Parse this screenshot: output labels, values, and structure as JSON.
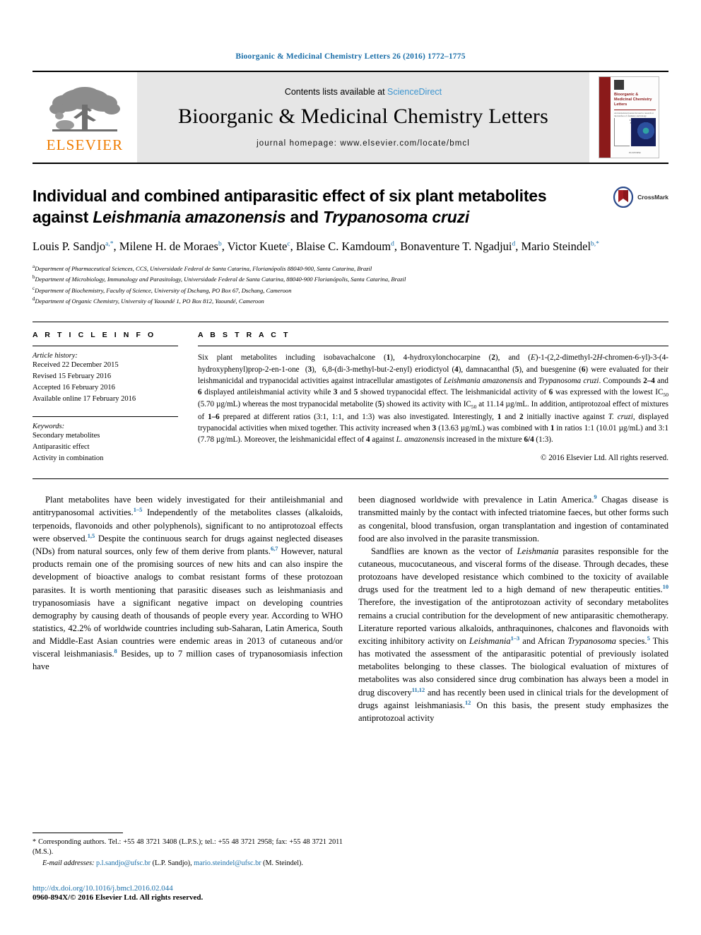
{
  "running_head": "Bioorganic & Medicinal Chemistry Letters 26 (2016) 1772–1775",
  "masthead": {
    "publisher_name": "ELSEVIER",
    "contents_prefix": "Contents lists available at ",
    "contents_link": "ScienceDirect",
    "journal_title": "Bioorganic & Medicinal Chemistry Letters",
    "homepage": "journal homepage: www.elsevier.com/locate/bmcl",
    "cover": {
      "title": "Bioorganic & Medicinal Chemistry Letters",
      "subtitle": "An international journal devoted to research at the interface of chemistry and biology",
      "volume_line": "Volume 26    Issue 7    1 April 2016",
      "editors": "Editors-in-Chief: B. E. Maryanoff, J. D. Elliott",
      "footer": "ELSEVIER",
      "figure_caption": "Available online at www.sciencedirect.com"
    }
  },
  "article": {
    "title_line1": "Individual and combined antiparasitic effect of six plant metabolites",
    "title_line2_pre": "against ",
    "title_line2_italic1": "Leishmania amazonensis",
    "title_line2_mid": " and ",
    "title_line2_italic2": "Trypanosoma cruzi",
    "crossmark_label": "CrossMark",
    "authors": [
      {
        "name": "Louis P. Sandjo",
        "marks": "a,*"
      },
      {
        "name": "Milene H. de Moraes",
        "marks": "b"
      },
      {
        "name": "Victor Kuete",
        "marks": "c"
      },
      {
        "name": "Blaise C. Kamdoum",
        "marks": "d"
      },
      {
        "name": "Bonaventure T. Ngadjui",
        "marks": "d"
      },
      {
        "name": "Mario Steindel",
        "marks": "b,*"
      }
    ],
    "affiliations": [
      {
        "mark": "a",
        "text": "Department of Pharmaceutical Sciences, CCS, Universidade Federal de Santa Catarina, Florianópolis 88040-900, Santa Catarina, Brazil"
      },
      {
        "mark": "b",
        "text": "Department of Microbiology, Immunology and Parasitology, Universidade Federal de Santa Catarina, 88040-900 Florianópolis, Santa Catarina, Brazil"
      },
      {
        "mark": "c",
        "text": "Department of Biochemistry, Faculty of Science, University of Dschang, PO Box 67, Dschang, Cameroon"
      },
      {
        "mark": "d",
        "text": "Department of Organic Chemistry, University of Yaoundé 1, PO Box 812, Yaoundé, Cameroon"
      }
    ]
  },
  "article_info": {
    "heading": "A R T I C L E   I N F O",
    "history_title": "Article history:",
    "history": [
      "Received 22 December 2015",
      "Revised 15 February 2016",
      "Accepted 16 February 2016",
      "Available online 17 February 2016"
    ],
    "keywords_title": "Keywords:",
    "keywords": [
      "Secondary metabolites",
      "Antiparasitic effect",
      "Activity in combination"
    ]
  },
  "abstract": {
    "heading": "A B S T R A C T",
    "copyright": "© 2016 Elsevier Ltd. All rights reserved."
  },
  "footnotes": {
    "corresponding": "* Corresponding authors. Tel.: +55 48 3721 3408 (L.P.S.); tel.: +55 48 3721 2958; fax: +55 48 3721 2011 (M.S.).",
    "email_label": "E-mail addresses:",
    "email1": "p.l.sandjo@ufsc.br",
    "email1_owner": "(L.P. Sandjo),",
    "email2": "mario.steindel@ufsc.br",
    "email2_owner": "(M. Steindel).",
    "doi": "http://dx.doi.org/10.1016/j.bmcl.2016.02.044",
    "issn_line": "0960-894X/© 2016 Elsevier Ltd. All rights reserved."
  },
  "colors": {
    "link_blue": "#1a6ea8",
    "sciencedirect_blue": "#3d95d0",
    "elsevier_orange": "#ef7c00",
    "cover_red": "#8b1a1a",
    "band_gray": "#e6e6e6"
  }
}
